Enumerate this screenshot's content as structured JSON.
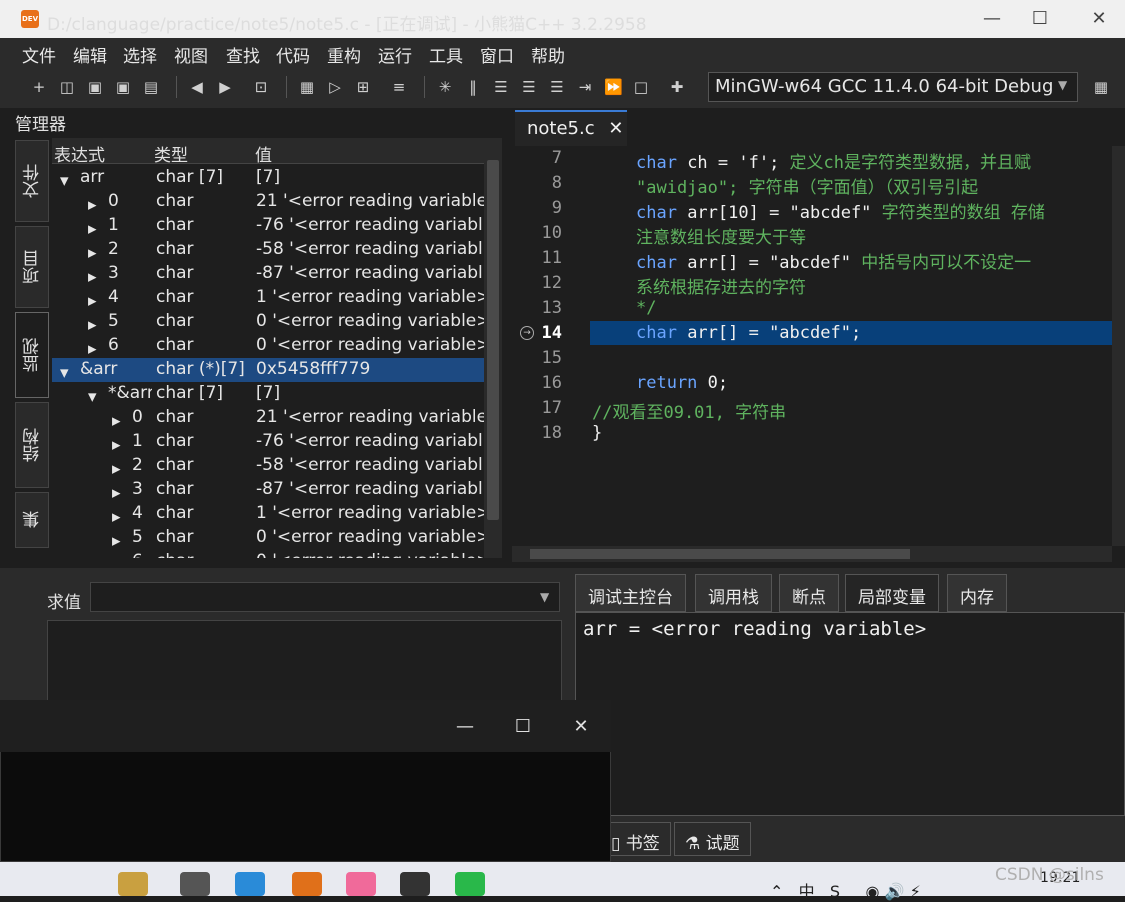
{
  "window": {
    "title": "D:/clanguage/practice/note5/note5.c - [正在调试] - 小熊猫C++ 3.2.2958",
    "app_icon_text": "DEV",
    "minimize": "—",
    "maximize": "☐",
    "close": "✕"
  },
  "menu": [
    "文件",
    "编辑",
    "选择",
    "视图",
    "查找",
    "代码",
    "重构",
    "运行",
    "工具",
    "窗口",
    "帮助"
  ],
  "toolbar": {
    "compiler": "MinGW-w64 GCC 11.4.0 64-bit Debug"
  },
  "manager": {
    "label": "管理器",
    "side_tabs": [
      "文件",
      "项目",
      "监视",
      "结构",
      "集"
    ]
  },
  "watch": {
    "headers": [
      "表达式",
      "类型",
      "值"
    ],
    "rows": [
      {
        "expr": "arr",
        "type": "char [7]",
        "value": "[7]",
        "level": 0,
        "expander": "▾"
      },
      {
        "expr": "0",
        "type": "char",
        "value": "21 '<error reading variable",
        "level": 1,
        "expander": "▸"
      },
      {
        "expr": "1",
        "type": "char",
        "value": "-76 '<error reading variabl",
        "level": 1,
        "expander": "▸"
      },
      {
        "expr": "2",
        "type": "char",
        "value": "-58 '<error reading variabl",
        "level": 1,
        "expander": "▸"
      },
      {
        "expr": "3",
        "type": "char",
        "value": "-87 '<error reading variabl",
        "level": 1,
        "expander": "▸"
      },
      {
        "expr": "4",
        "type": "char",
        "value": "1 '<error reading variable>",
        "level": 1,
        "expander": "▸"
      },
      {
        "expr": "5",
        "type": "char",
        "value": "0 '<error reading variable>",
        "level": 1,
        "expander": "▸"
      },
      {
        "expr": "6",
        "type": "char",
        "value": "0 '<error reading variable>",
        "level": 1,
        "expander": "▸"
      },
      {
        "expr": "&arr",
        "type": "char (*)[7]",
        "value": "0x5458fff779",
        "level": 0,
        "expander": "▾",
        "selected": true
      },
      {
        "expr": "*&arr",
        "type": "char [7]",
        "value": "[7]",
        "level": 1,
        "expander": "▾"
      },
      {
        "expr": "0",
        "type": "char",
        "value": "21 '<error reading variable",
        "level": 2,
        "expander": "▸"
      },
      {
        "expr": "1",
        "type": "char",
        "value": "-76 '<error reading variabl",
        "level": 2,
        "expander": "▸"
      },
      {
        "expr": "2",
        "type": "char",
        "value": "-58 '<error reading variabl",
        "level": 2,
        "expander": "▸"
      },
      {
        "expr": "3",
        "type": "char",
        "value": "-87 '<error reading variabl",
        "level": 2,
        "expander": "▸"
      },
      {
        "expr": "4",
        "type": "char",
        "value": "1 '<error reading variable>",
        "level": 2,
        "expander": "▸"
      },
      {
        "expr": "5",
        "type": "char",
        "value": "0 '<error reading variable>",
        "level": 2,
        "expander": "▸"
      },
      {
        "expr": "6",
        "type": "char",
        "value": "0 '<error reading variable>",
        "level": 2,
        "expander": "▸"
      }
    ]
  },
  "editor": {
    "tab": "note5.c",
    "tab_close": "✕",
    "current_line": 14,
    "lines": [
      {
        "n": "7",
        "parts": [
          [
            "kw",
            "char"
          ],
          [
            "id",
            " ch = 'f';  "
          ],
          [
            "cm",
            "定义ch是字符类型数据，并且赋"
          ]
        ]
      },
      {
        "n": "8",
        "parts": [
          [
            "cm",
            "\"awidjao\";      字符串（字面值）（双引号引起"
          ]
        ]
      },
      {
        "n": "9",
        "parts": [
          [
            "kw",
            "char"
          ],
          [
            "id",
            " arr[10] = \"abcdef\"  "
          ],
          [
            "cm",
            "字符类型的数组 存储"
          ]
        ]
      },
      {
        "n": "10",
        "parts": [
          [
            "cm",
            "                     注意数组长度要大于等"
          ]
        ]
      },
      {
        "n": "11",
        "parts": [
          [
            "kw",
            "char"
          ],
          [
            "id",
            " arr[] = \"abcdef\"    "
          ],
          [
            "cm",
            "中括号内可以不设定一"
          ]
        ]
      },
      {
        "n": "12",
        "parts": [
          [
            "cm",
            "                     系统根据存进去的字符"
          ]
        ]
      },
      {
        "n": "13",
        "parts": [
          [
            "cm",
            "*/"
          ]
        ]
      },
      {
        "n": "14",
        "parts": [
          [
            "kw",
            "char"
          ],
          [
            "id",
            " arr[] = \"abcdef\";"
          ]
        ]
      },
      {
        "n": "15",
        "parts": []
      },
      {
        "n": "16",
        "parts": [
          [
            "kw",
            "return"
          ],
          [
            "id",
            " 0;"
          ]
        ]
      },
      {
        "n": "17",
        "parts": [
          [
            "cm",
            "//观看至09.01, 字符串"
          ]
        ]
      },
      {
        "n": "18",
        "parts": [
          [
            "id",
            "}"
          ]
        ]
      }
    ]
  },
  "bottom": {
    "eval_label": "求值",
    "tabs": [
      "调试主控台",
      "调用栈",
      "断点",
      "局部变量",
      "内存"
    ],
    "active_tab": "局部变量",
    "locals_text": "arr = <error reading variable>",
    "lower_tabs": [
      "书签",
      "试题"
    ]
  },
  "console": {
    "minimize": "—",
    "maximize": "☐",
    "close": "✕"
  },
  "taskbar": {
    "watermark": "CSDN @silns",
    "time": "19:21"
  }
}
